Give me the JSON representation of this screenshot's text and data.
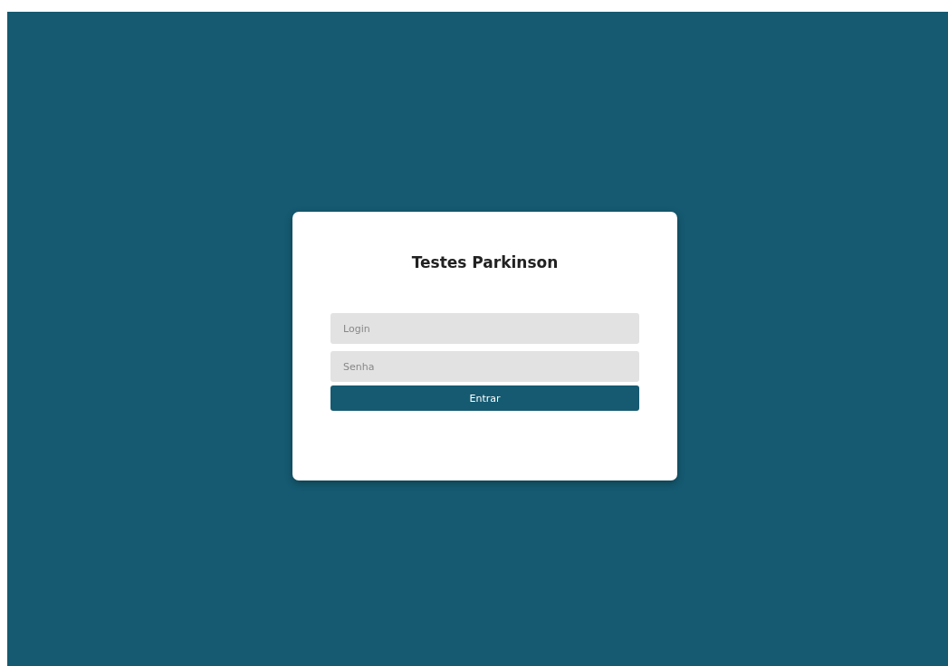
{
  "title": "Testes Parkinson",
  "fields": [
    {
      "placeholder": "Login"
    },
    {
      "placeholder": "Senha"
    }
  ],
  "button": "Entrar"
}
